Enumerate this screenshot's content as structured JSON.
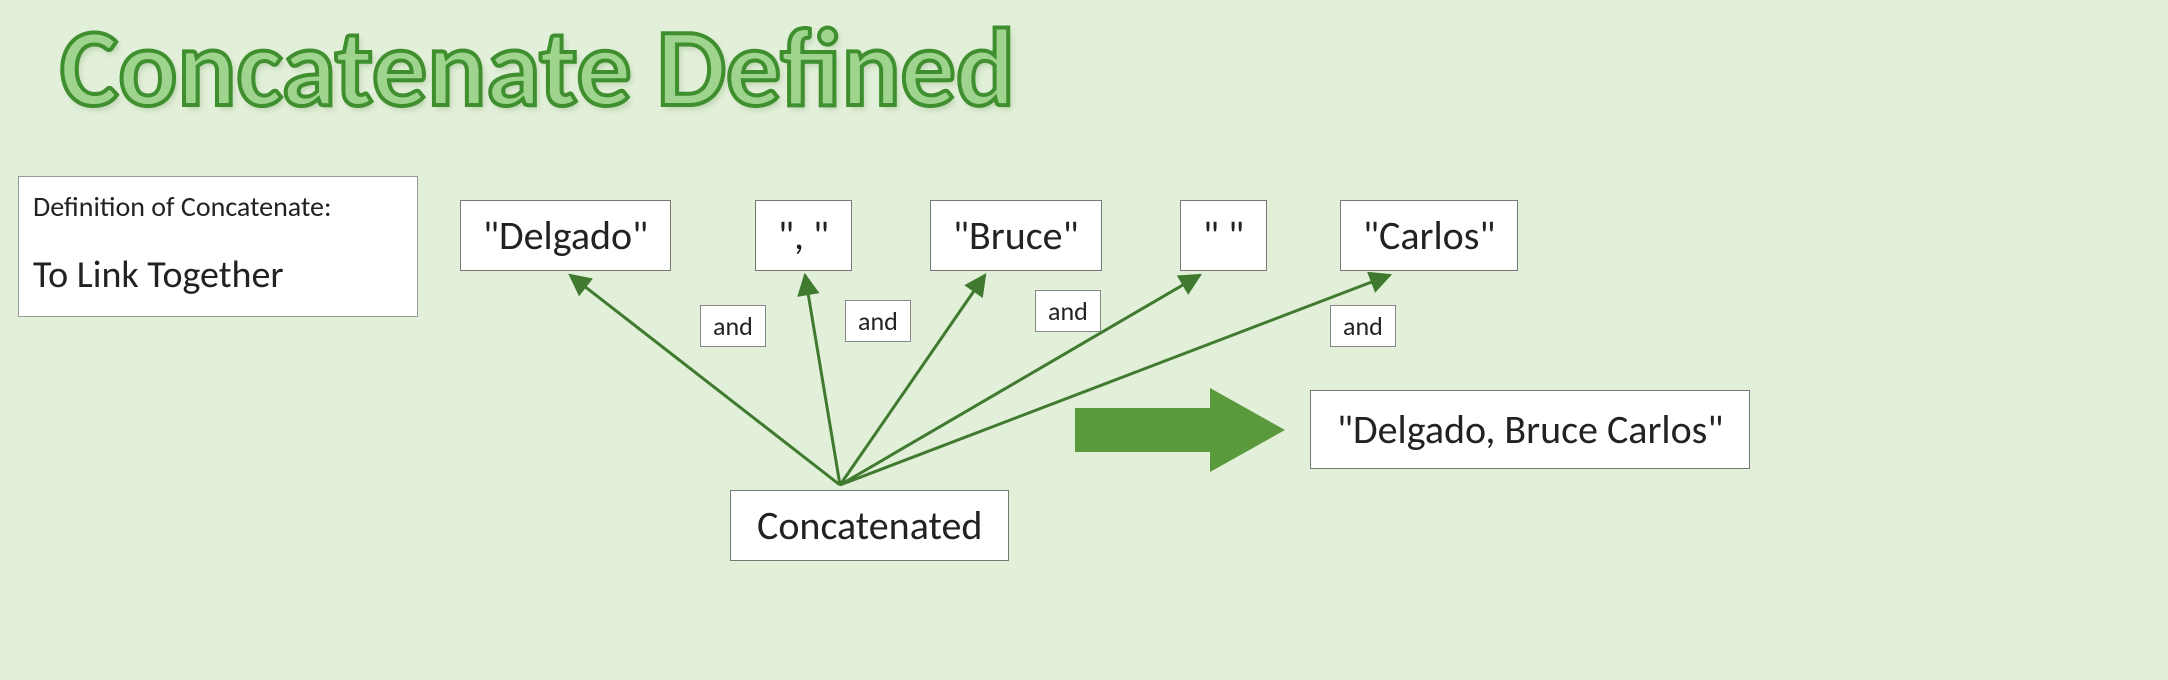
{
  "title": "Concatenate Defined",
  "definition": {
    "heading": "Definition of Concatenate:",
    "text": "To Link Together"
  },
  "pieces": {
    "p1": "\"Delgado\"",
    "p2": "\", \"",
    "p3": "\"Bruce\"",
    "p4": "\" \"",
    "p5": "\"Carlos\""
  },
  "connector": "and",
  "source_label": "Concatenated",
  "result": "\"Delgado, Bruce Carlos\"",
  "colors": {
    "arrow_stroke": "#3f7a2f",
    "big_arrow_fill": "#5a9a3d"
  }
}
